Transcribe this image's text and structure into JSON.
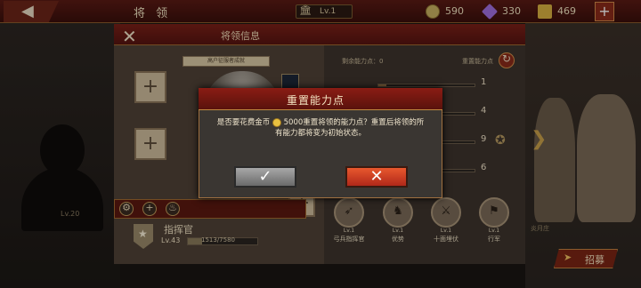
{
  "topbar": {
    "title": "将 领",
    "level_badge": "Lv.1",
    "resources": [
      {
        "name": "coin",
        "value": "590",
        "color": "#c8b060"
      },
      {
        "name": "gem",
        "value": "330",
        "color": "#a070e0"
      },
      {
        "name": "food",
        "value": "469",
        "color": "#d8b040"
      }
    ],
    "plus_label": "+"
  },
  "background": {
    "locked_level": "Lv.20",
    "right_label": "炎月庄",
    "recruit_label": "招募"
  },
  "panel": {
    "title": "将领信息",
    "achievement_label": "高户征服者成就",
    "remaining_points_label": "剩余能力点：0",
    "reset_points_label": "重置能力点",
    "stats": [
      {
        "value": "1",
        "level": 0.08
      },
      {
        "value": "4",
        "level": 0.3
      },
      {
        "value": "9",
        "level": 0.65
      },
      {
        "value": "6",
        "level": 0.45
      }
    ],
    "skills": [
      {
        "level": "Lv.1",
        "name": "弓兵指挥官",
        "icon": "bow-icon",
        "glyph": "➶"
      },
      {
        "level": "Lv.1",
        "name": "优势",
        "icon": "soldiers-icon",
        "glyph": "♞"
      },
      {
        "level": "Lv.1",
        "name": "十面埋伏",
        "icon": "ambush-icon",
        "glyph": "⚔"
      },
      {
        "level": "Lv.1",
        "name": "行军",
        "icon": "march-icon",
        "glyph": "⚑"
      }
    ],
    "commander": {
      "name": "指挥官",
      "level": "Lv.43",
      "exp": "1513/7580",
      "exp_fraction": 0.2
    }
  },
  "dialog": {
    "title": "重置能力点",
    "message_pre": "是否要花费金币",
    "message_post": "5000重置将领的能力点？重置后将领的所有能力都将变为初始状态。",
    "confirm_icon": "✓",
    "cancel_icon": "✕"
  },
  "colors": {
    "header_red": "#7a2018",
    "cancel_orange": "#e8582e",
    "confirm_gray": "#8a8a8a"
  }
}
